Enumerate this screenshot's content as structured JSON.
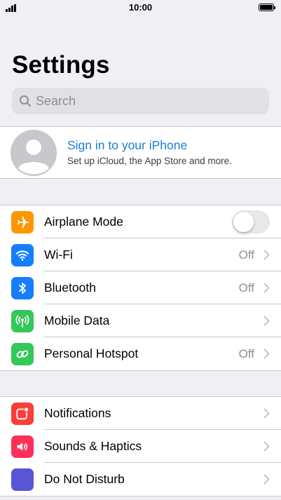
{
  "status_bar": {
    "time": "10:00"
  },
  "header": {
    "title": "Settings"
  },
  "search": {
    "placeholder": "Search"
  },
  "account": {
    "title": "Sign in to your iPhone",
    "subtitle": "Set up iCloud, the App Store and more."
  },
  "groups": {
    "connectivity": {
      "airplane": {
        "label": "Airplane Mode",
        "icon": "airplane-icon",
        "color": "#ff9500",
        "toggle_on": false
      },
      "wifi": {
        "label": "Wi-Fi",
        "value": "Off",
        "icon": "wifi-icon",
        "color": "#157efb"
      },
      "bluetooth": {
        "label": "Bluetooth",
        "value": "Off",
        "icon": "bluetooth-icon",
        "color": "#157efb"
      },
      "mobile_data": {
        "label": "Mobile Data",
        "icon": "antenna-icon",
        "color": "#34c759"
      },
      "hotspot": {
        "label": "Personal Hotspot",
        "value": "Off",
        "icon": "hotspot-icon",
        "color": "#34c759"
      }
    },
    "alerts": {
      "notifications": {
        "label": "Notifications",
        "icon": "notifications-icon",
        "color": "#fc3d39"
      },
      "sounds": {
        "label": "Sounds & Haptics",
        "icon": "speaker-icon",
        "color": "#fc3159"
      },
      "dnd": {
        "label": "Do Not Disturb",
        "icon": "moon-icon",
        "color": "#5856d6"
      }
    }
  }
}
